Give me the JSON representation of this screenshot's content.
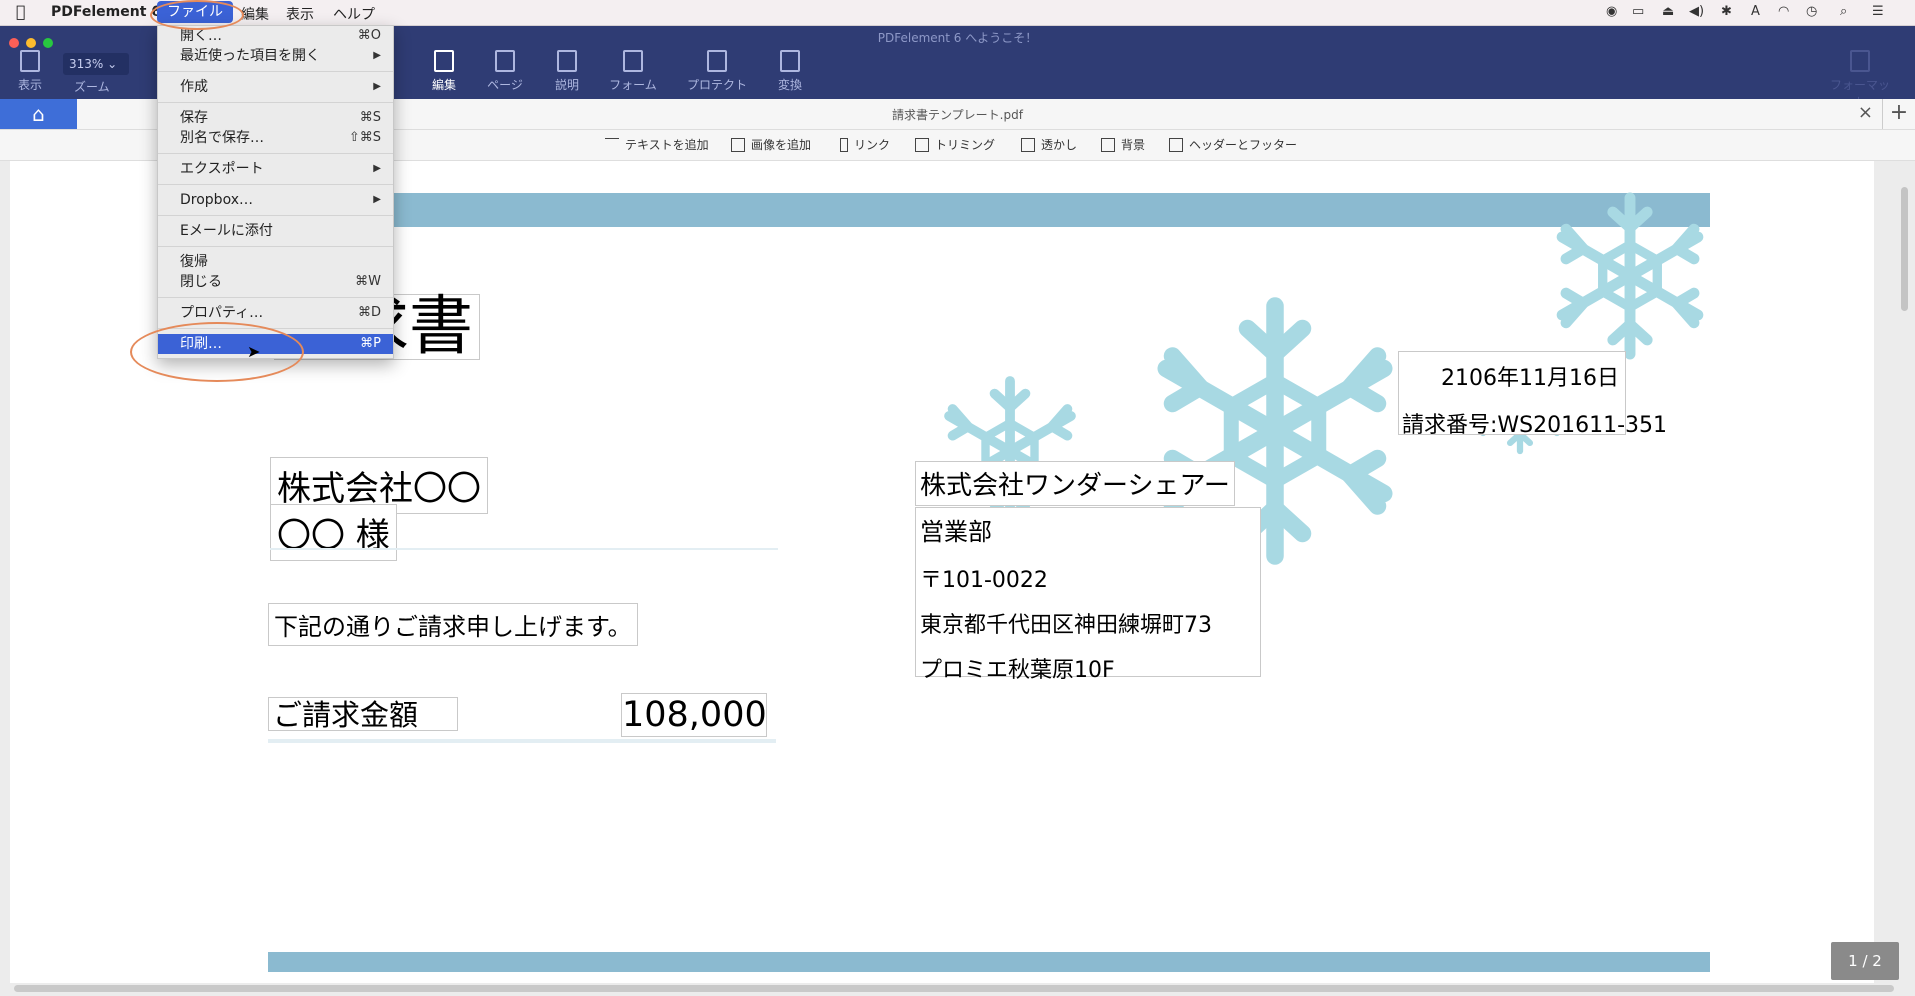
{
  "menubar": {
    "app_name": "PDFelement 6",
    "menus": [
      "ファイル",
      "編集",
      "表示",
      "ヘルプ"
    ]
  },
  "window": {
    "title": "PDFelement 6 へようこそ！"
  },
  "toolbar": {
    "zoom_value": "313%",
    "items": [
      "表示",
      "ズーム",
      "編集",
      "ページ",
      "説明",
      "フォーム",
      "プロテクト",
      "変換",
      "フォーマット"
    ]
  },
  "tab": {
    "filename": "請求書テンプレート.pdf"
  },
  "edit_toolbar": {
    "items": [
      "テキストを追加",
      "画像を追加",
      "リンク",
      "トリミング",
      "透かし",
      "背景",
      "ヘッダーとフッター"
    ]
  },
  "file_menu": {
    "open": {
      "label": "開く…",
      "shortcut": "⌘O"
    },
    "recent": {
      "label": "最近使った項目を開く"
    },
    "create": {
      "label": "作成"
    },
    "save": {
      "label": "保存",
      "shortcut": "⌘S"
    },
    "save_as": {
      "label": "別名で保存…",
      "shortcut": "⇧⌘S"
    },
    "export": {
      "label": "エクスポート"
    },
    "dropbox": {
      "label": "Dropbox…"
    },
    "email": {
      "label": "Eメールに添付"
    },
    "revert": {
      "label": "復帰"
    },
    "close": {
      "label": "閉じる",
      "shortcut": "⌘W"
    },
    "properties": {
      "label": "プロパティ…",
      "shortcut": "⌘D"
    },
    "print": {
      "label": "印刷…",
      "shortcut": "⌘P"
    }
  },
  "document": {
    "title": "請求書",
    "date": "2106年11月16日",
    "invoice_no": "請求番号:WS201611-351",
    "client_company": "株式会社〇〇",
    "client_name": "〇〇 様",
    "company": "株式会社ワンダーシェアー",
    "dept": "営業部",
    "postal": "〒101-0022",
    "address1": "東京都千代田区神田練塀町73",
    "address2": "プロミエ秋葉原10F",
    "message": "下記の通りご請求申し上げます。",
    "amount_label": "ご請求金額",
    "amount": "108,000"
  },
  "pager": {
    "label": "1 / 2"
  },
  "colors": {
    "accent": "#3b62d6",
    "toolbar": "#2f3c74",
    "band": "#8bbad0",
    "snowflake": "#a8d9e3",
    "highlight_ring": "#e58a5a"
  }
}
